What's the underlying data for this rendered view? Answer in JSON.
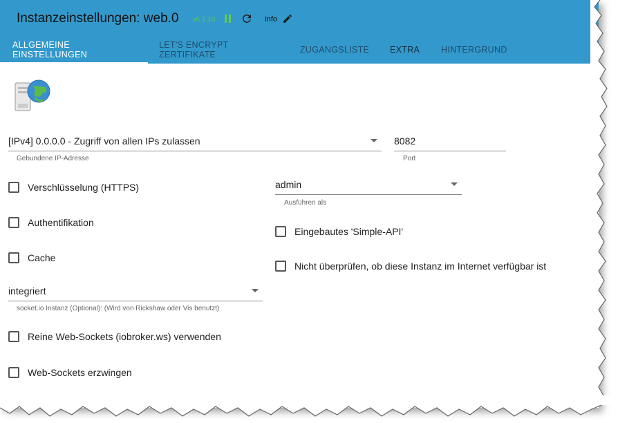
{
  "header": {
    "title": "Instanzeinstellungen: web.0",
    "version": "v6.1.10",
    "info_label": "info",
    "background_color": "#3399cc",
    "icons": [
      "pause-icon",
      "reload-icon",
      "edit-icon"
    ]
  },
  "tabs": [
    {
      "label": "ALLGEMEINE EINSTELLUNGEN",
      "active": true
    },
    {
      "label": "LET'S ENCRYPT ZERTIFIKATE",
      "active": false
    },
    {
      "label": "ZUGANGSLISTE",
      "active": false
    },
    {
      "label": "EXTRA",
      "active": false
    },
    {
      "label": "HINTERGRUND",
      "active": false
    }
  ],
  "form": {
    "bind_ip": {
      "value": "[IPv4] 0.0.0.0 - Zugriff von allen IPs zulassen",
      "helper": "Gebundene IP-Adresse"
    },
    "port": {
      "value": "8082",
      "helper": "Port"
    },
    "run_as": {
      "value": "admin",
      "helper": "Ausführen als"
    },
    "socketio": {
      "value": "integriert",
      "helper": "socket.io Instanz (Optional): (Wird von Rickshaw oder Vis benutzt)"
    },
    "checkboxes": {
      "https": {
        "label": "Verschlüsselung (HTTPS)",
        "checked": false
      },
      "auth": {
        "label": "Authentifikation",
        "checked": false
      },
      "cache": {
        "label": "Cache",
        "checked": false
      },
      "simple_api": {
        "label": "Eingebautes 'Simple-API'",
        "checked": false
      },
      "no_check": {
        "label": "Nicht überprüfen, ob diese Instanz im Internet verfügbar ist",
        "checked": false
      },
      "pure_ws": {
        "label": "Reine Web-Sockets (iobroker.ws) verwenden",
        "checked": false
      },
      "force_ws": {
        "label": "Web-Sockets erzwingen",
        "checked": false
      }
    }
  }
}
